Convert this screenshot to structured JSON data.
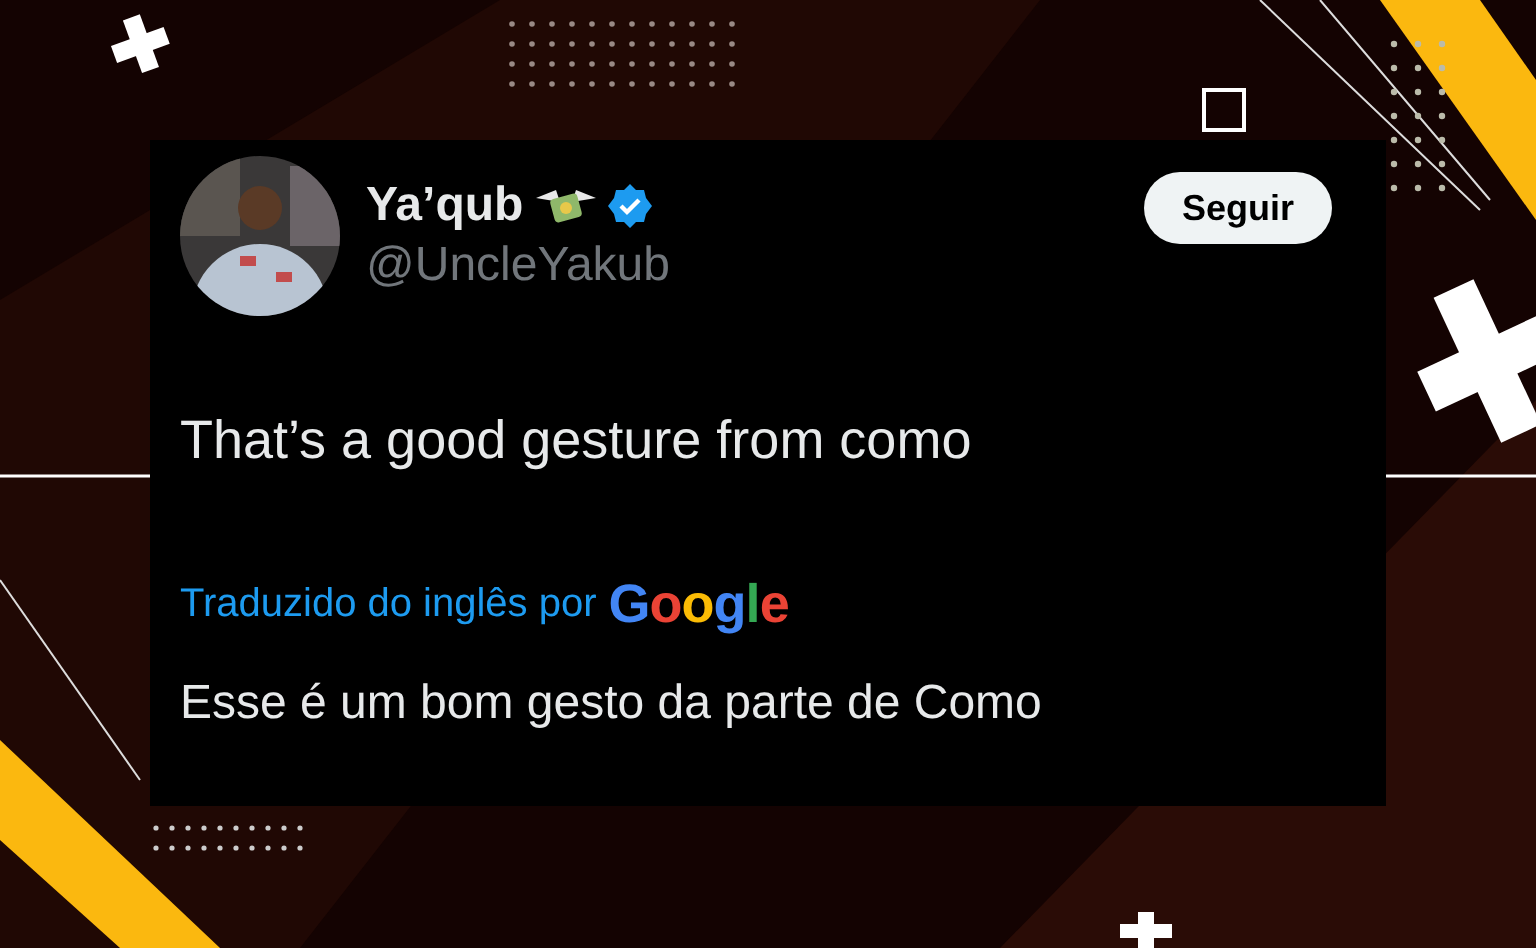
{
  "tweet": {
    "author": {
      "name": "Ya’qub",
      "handle": "@UncleYakub",
      "verified": true
    },
    "follow_button": "Seguir",
    "text": "That’s a good gesture from como",
    "translation": {
      "label": "Traduzido do inglês por",
      "provider": "Google",
      "text": "Esse é um bom gesto da parte de Como"
    }
  }
}
